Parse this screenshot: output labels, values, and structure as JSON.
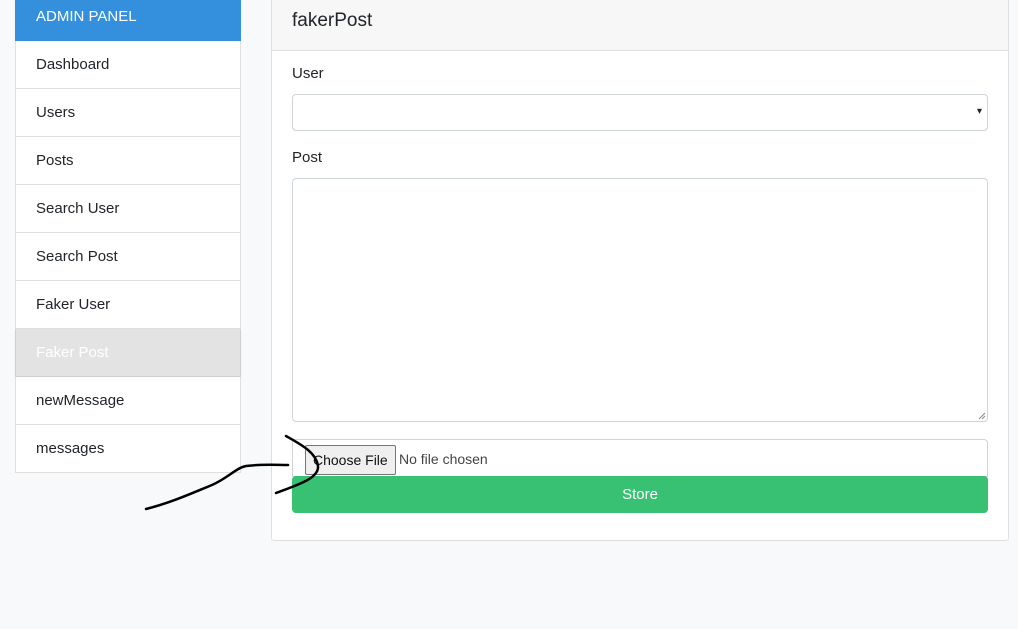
{
  "sidebar": {
    "header": "ADMIN PANEL",
    "items": [
      {
        "label": "Dashboard"
      },
      {
        "label": "Users"
      },
      {
        "label": "Posts"
      },
      {
        "label": "Search User"
      },
      {
        "label": "Search Post"
      },
      {
        "label": "Faker User"
      },
      {
        "label": "Faker Post"
      },
      {
        "label": "newMessage"
      },
      {
        "label": "messages"
      }
    ],
    "active_item": "Faker Post"
  },
  "card": {
    "title": "fakerPost",
    "user_label": "User",
    "user_selected": "",
    "post_label": "Post",
    "post_value": "",
    "file_button_label": "Choose File",
    "file_status": "No file chosen",
    "submit_label": "Store"
  },
  "colors": {
    "sidebar_header_bg": "#3490dc",
    "submit_bg": "#38c172",
    "active_item_bg": "#e3e3e3",
    "annotation_stroke": "#000000"
  },
  "icons": {
    "select_caret": "chevron-down-icon",
    "textarea_grip": "resize-grip-icon"
  }
}
